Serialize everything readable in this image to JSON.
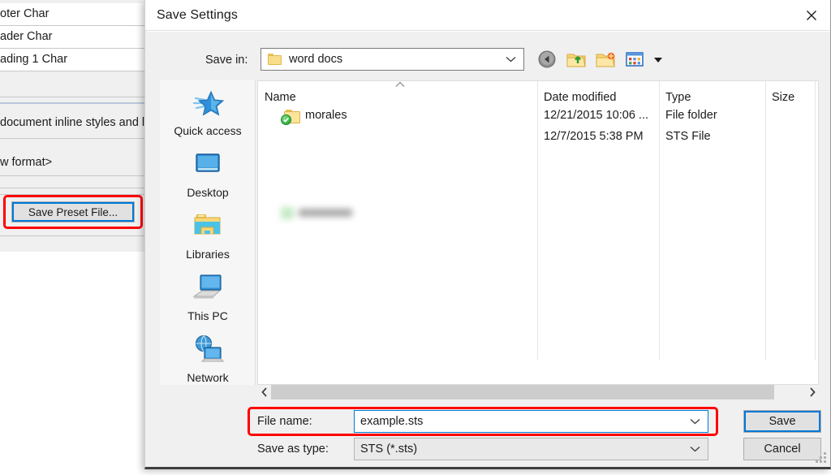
{
  "background_app": {
    "rows": [
      {
        "text": "oter Char"
      },
      {
        "text": "ader Char"
      },
      {
        "text": "ading 1 Char"
      },
      {
        "text": ""
      },
      {
        "text": "document inline styles and list f"
      },
      {
        "text": "w format>"
      },
      {
        "text": ""
      },
      {
        "text": ""
      }
    ],
    "preset_button_label": "Save Preset File..."
  },
  "dialog": {
    "title": "Save Settings",
    "close_icon": "close-icon",
    "save_in": {
      "label": "Save in:",
      "value": "word docs",
      "folder_icon": "folder-icon",
      "chevron_icon": "chevron-down-icon"
    },
    "toolbar": [
      {
        "name": "back-button",
        "icon": "back-arrow-icon"
      },
      {
        "name": "up-one-level-button",
        "icon": "folder-up-icon"
      },
      {
        "name": "new-folder-button",
        "icon": "new-folder-icon"
      },
      {
        "name": "views-button",
        "icon": "views-grid-icon"
      },
      {
        "name": "views-dropdown",
        "icon": "chevron-down-icon"
      }
    ],
    "places": [
      {
        "label": "Quick access",
        "icon": "star-icon"
      },
      {
        "label": "Desktop",
        "icon": "monitor-icon"
      },
      {
        "label": "Libraries",
        "icon": "libraries-folder-icon"
      },
      {
        "label": "This PC",
        "icon": "computer-icon"
      },
      {
        "label": "Network",
        "icon": "network-globe-icon"
      }
    ],
    "file_list": {
      "sort_indicator": "˄",
      "columns": [
        "Name",
        "Date modified",
        "Type",
        "Size"
      ],
      "rows": [
        {
          "name": "morales",
          "date_modified": "12/21/2015 10:06 ...",
          "type": "File folder",
          "size": "",
          "icon": "folder-icon",
          "badge": "sync-check-icon",
          "redacted": false
        },
        {
          "name": "",
          "date_modified": "12/7/2015 5:38 PM",
          "type": "STS File",
          "size": "",
          "icon": "file-icon",
          "badge": "sync-check-icon",
          "redacted": true
        }
      ]
    },
    "scrollbar": {
      "left_arrow": "chevron-left-icon",
      "right_arrow": "chevron-right-icon"
    },
    "file_name": {
      "label": "File name:",
      "value": "example.sts",
      "chevron_icon": "chevron-down-icon"
    },
    "save_as_type": {
      "label": "Save as type:",
      "value": "STS (*.sts)",
      "chevron_icon": "chevron-down-icon"
    },
    "buttons": {
      "save": "Save",
      "cancel": "Cancel"
    }
  },
  "annotations": {
    "highlight_color": "#ff0000",
    "focus_color": "#0078d7"
  }
}
